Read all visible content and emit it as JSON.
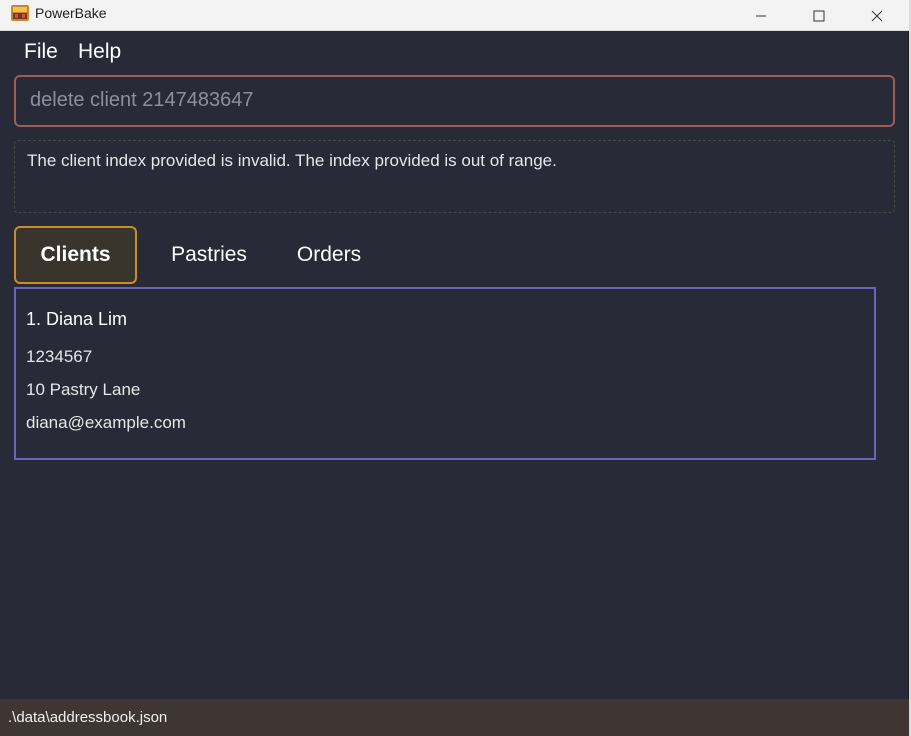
{
  "window": {
    "title": "PowerBake",
    "icon": "powerbake-app-icon"
  },
  "menu": {
    "items": [
      "File",
      "Help"
    ]
  },
  "command": {
    "value": "delete client 2147483647"
  },
  "result": {
    "message": "The client index provided is invalid. The index provided is out of range."
  },
  "tabs": [
    {
      "label": "Clients",
      "active": true
    },
    {
      "label": "Pastries",
      "active": false
    },
    {
      "label": "Orders",
      "active": false
    }
  ],
  "clients": [
    {
      "name": "1. Diana Lim",
      "phone": "1234567",
      "address": "10 Pastry Lane",
      "email": "diana@example.com"
    }
  ],
  "status": {
    "path": ".\\data\\addressbook.json"
  },
  "colors": {
    "background": "#282a37",
    "command_border": "#9e5c55",
    "active_tab_border": "#c98b2e",
    "list_border": "#6a65b8",
    "statusbar": "#3f3634"
  }
}
